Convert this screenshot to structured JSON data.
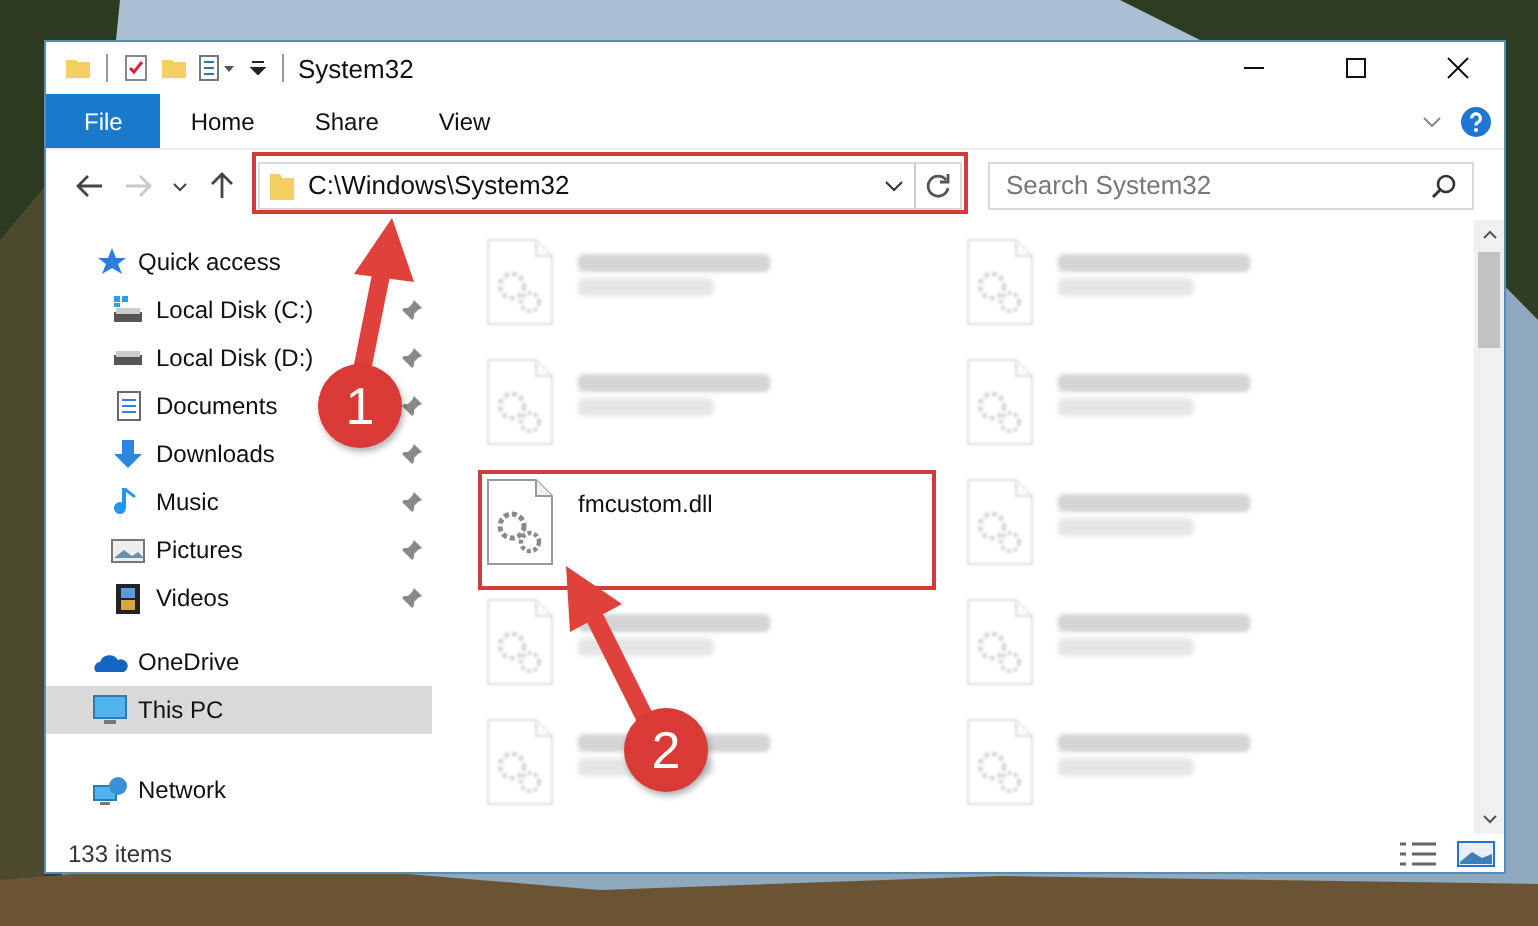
{
  "window": {
    "title": "System32"
  },
  "ribbon": {
    "tabs": [
      {
        "label": "File",
        "kind": "file"
      },
      {
        "label": "Home",
        "kind": "tab"
      },
      {
        "label": "Share",
        "kind": "tab"
      },
      {
        "label": "View",
        "kind": "tab"
      }
    ]
  },
  "address": {
    "path": "C:\\Windows\\System32"
  },
  "search": {
    "placeholder": "Search System32"
  },
  "nav": {
    "items": [
      {
        "label": "Quick access",
        "kind": "star",
        "selected": false,
        "children": [
          {
            "label": "Local Disk (C:)",
            "kind": "disk-c",
            "pinned": true,
            "selected": false
          },
          {
            "label": "Local Disk (D:)",
            "kind": "disk",
            "pinned": true,
            "selected": false
          },
          {
            "label": "Documents",
            "kind": "docs",
            "pinned": true,
            "selected": false
          },
          {
            "label": "Downloads",
            "kind": "down",
            "pinned": true,
            "selected": false
          },
          {
            "label": "Music",
            "kind": "music",
            "pinned": true,
            "selected": false
          },
          {
            "label": "Pictures",
            "kind": "pics",
            "pinned": true,
            "selected": false
          },
          {
            "label": "Videos",
            "kind": "video",
            "pinned": true,
            "selected": false
          }
        ]
      },
      {
        "label": "OneDrive",
        "kind": "cloud",
        "selected": false
      },
      {
        "label": "This PC",
        "kind": "pc",
        "selected": true
      },
      {
        "label": "Network",
        "kind": "network",
        "selected": false
      }
    ]
  },
  "files": [
    {
      "faded": true
    },
    {
      "faded": true
    },
    {
      "faded": true
    },
    {
      "faded": true
    },
    {
      "name": "fmcustom.dll",
      "faded": false
    },
    {
      "faded": true
    },
    {
      "faded": true
    },
    {
      "faded": true
    },
    {
      "faded": true
    },
    {
      "faded": true
    }
  ],
  "status_bar": {
    "count": "133 items"
  },
  "annotations": [
    {
      "number": "1"
    },
    {
      "number": "2"
    }
  ]
}
